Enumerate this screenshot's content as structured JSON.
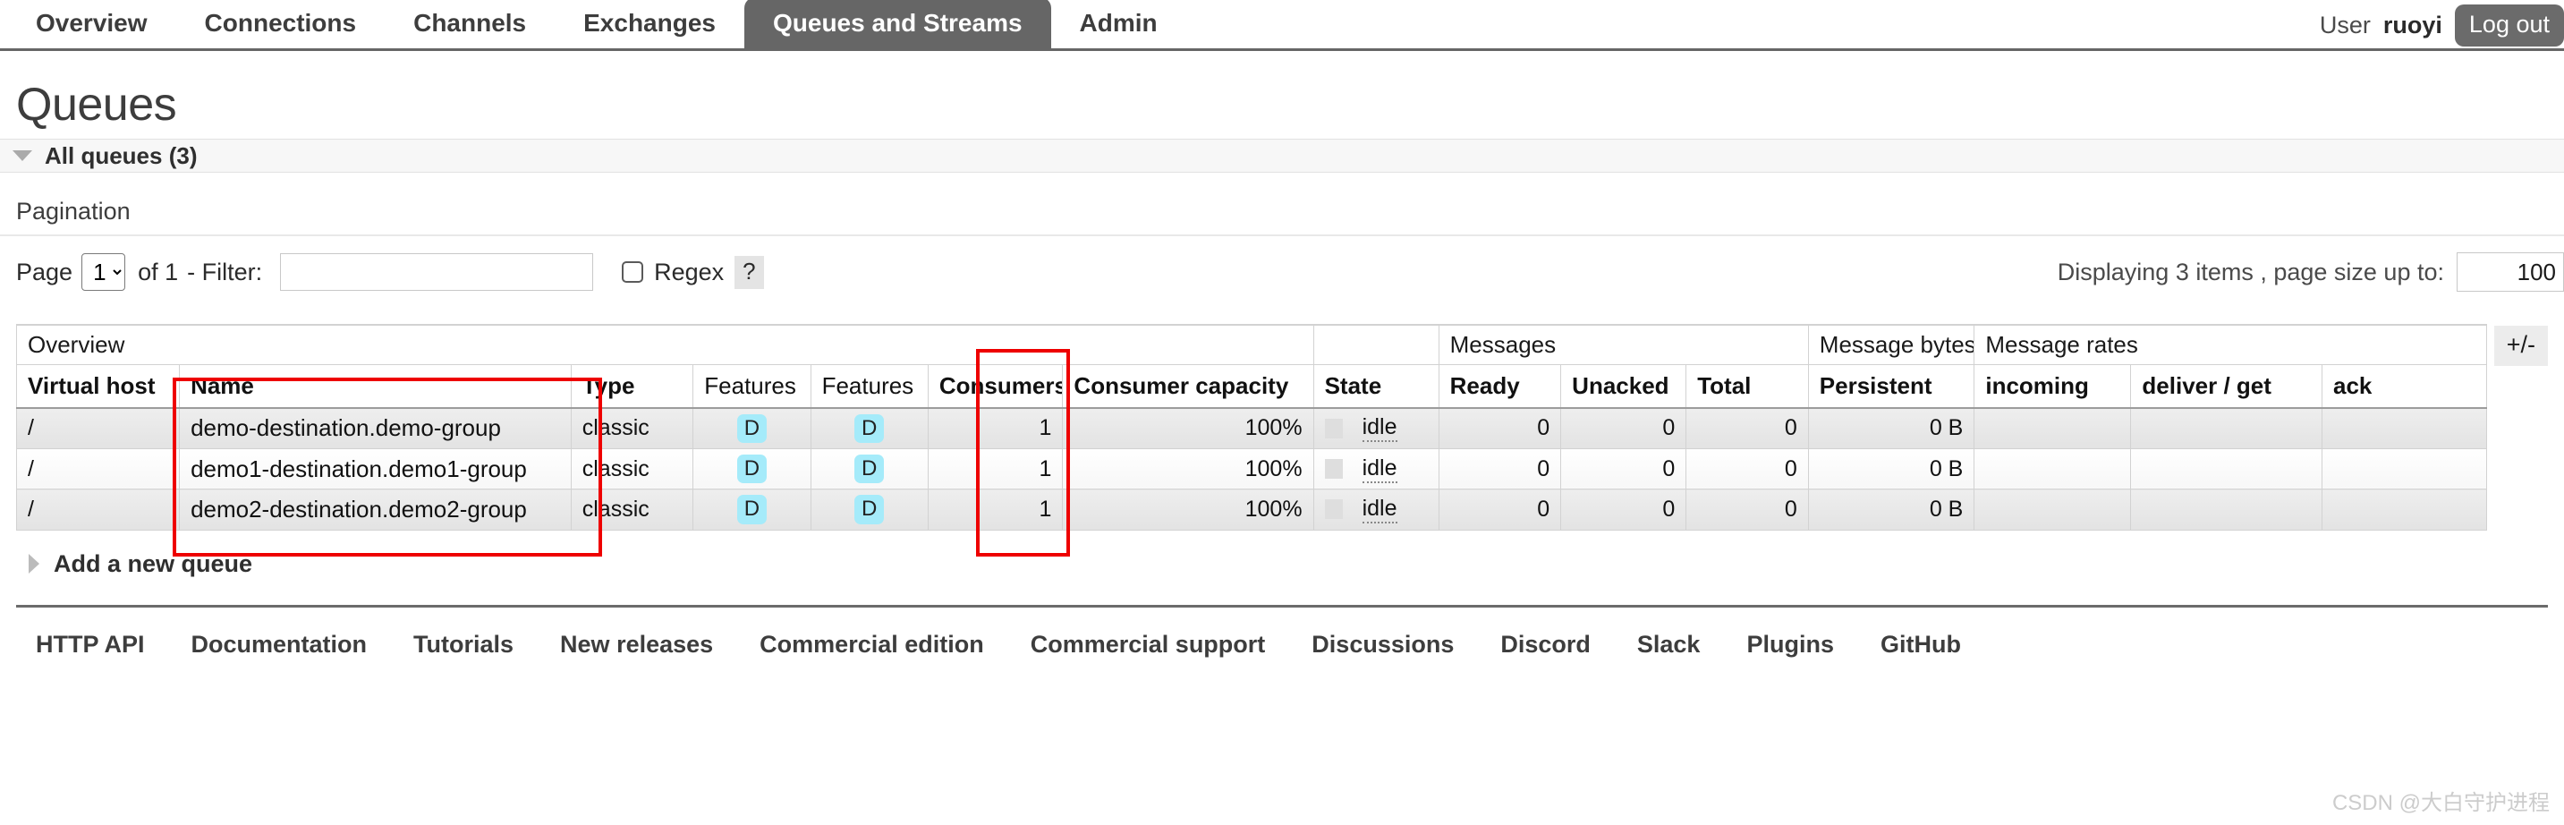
{
  "nav": {
    "tabs": [
      {
        "label": "Overview",
        "active": false
      },
      {
        "label": "Connections",
        "active": false
      },
      {
        "label": "Channels",
        "active": false
      },
      {
        "label": "Exchanges",
        "active": false
      },
      {
        "label": "Queues and Streams",
        "active": true
      },
      {
        "label": "Admin",
        "active": false
      }
    ],
    "user_label": "User",
    "user_name": "ruoyi",
    "logout_label": "Log out"
  },
  "page": {
    "title": "Queues",
    "section_label": "All queues (3)"
  },
  "pagination": {
    "title": "Pagination",
    "page_label": "Page",
    "page_value": "1",
    "page_options": [
      "1"
    ],
    "of_label": "of 1",
    "filter_label": "- Filter:",
    "filter_value": "",
    "filter_placeholder": "",
    "regex_label": "Regex",
    "regex_help": "?",
    "regex_checked": false,
    "displaying_label": "Displaying 3 items , page size up to:",
    "page_size_value": "100"
  },
  "table": {
    "group_headers": [
      {
        "label": "Overview",
        "span": 7
      },
      {
        "label": "",
        "span": 1
      },
      {
        "label": "Messages",
        "span": 3
      },
      {
        "label": "Message bytes",
        "span": 1
      },
      {
        "label": "Message rates",
        "span": 3
      }
    ],
    "columns": [
      {
        "label": "Virtual host",
        "bold": true,
        "align": "left"
      },
      {
        "label": "Name",
        "bold": true,
        "align": "left"
      },
      {
        "label": "Type",
        "bold": true,
        "align": "left"
      },
      {
        "label": "Features",
        "bold": false,
        "align": "left"
      },
      {
        "label": "Features",
        "bold": false,
        "align": "left"
      },
      {
        "label": "Consumers",
        "bold": true,
        "align": "left"
      },
      {
        "label": "Consumer capacity",
        "bold": true,
        "align": "left"
      },
      {
        "label": "State",
        "bold": true,
        "align": "left"
      },
      {
        "label": "Ready",
        "bold": true,
        "align": "left"
      },
      {
        "label": "Unacked",
        "bold": true,
        "align": "left"
      },
      {
        "label": "Total",
        "bold": true,
        "align": "left"
      },
      {
        "label": "Persistent",
        "bold": true,
        "align": "left"
      },
      {
        "label": "incoming",
        "bold": true,
        "align": "left"
      },
      {
        "label": "deliver / get",
        "bold": true,
        "align": "left"
      },
      {
        "label": "ack",
        "bold": true,
        "align": "left"
      }
    ],
    "toggle_columns_label": "+/-",
    "rows": [
      {
        "vhost": "/",
        "name": "demo-destination.demo-group",
        "type": "classic",
        "feature1": "D",
        "feature2": "D",
        "consumers": "1",
        "consumer_capacity": "100%",
        "state": "idle",
        "ready": "0",
        "unacked": "0",
        "total": "0",
        "persistent": "0 B",
        "incoming": "",
        "deliver_get": "",
        "ack": ""
      },
      {
        "vhost": "/",
        "name": "demo1-destination.demo1-group",
        "type": "classic",
        "feature1": "D",
        "feature2": "D",
        "consumers": "1",
        "consumer_capacity": "100%",
        "state": "idle",
        "ready": "0",
        "unacked": "0",
        "total": "0",
        "persistent": "0 B",
        "incoming": "",
        "deliver_get": "",
        "ack": ""
      },
      {
        "vhost": "/",
        "name": "demo2-destination.demo2-group",
        "type": "classic",
        "feature1": "D",
        "feature2": "D",
        "consumers": "1",
        "consumer_capacity": "100%",
        "state": "idle",
        "ready": "0",
        "unacked": "0",
        "total": "0",
        "persistent": "0 B",
        "incoming": "",
        "deliver_get": "",
        "ack": ""
      }
    ]
  },
  "add_queue": {
    "label": "Add a new queue"
  },
  "footer": {
    "links": [
      "HTTP API",
      "Documentation",
      "Tutorials",
      "New releases",
      "Commercial edition",
      "Commercial support",
      "Discussions",
      "Discord",
      "Slack",
      "Plugins",
      "GitHub"
    ]
  },
  "watermark": {
    "text": "CSDN @大白守护进程"
  },
  "colors": {
    "accent": "#666666",
    "feature_badge": "#a5ebfa",
    "annotation": "#ee0000"
  }
}
